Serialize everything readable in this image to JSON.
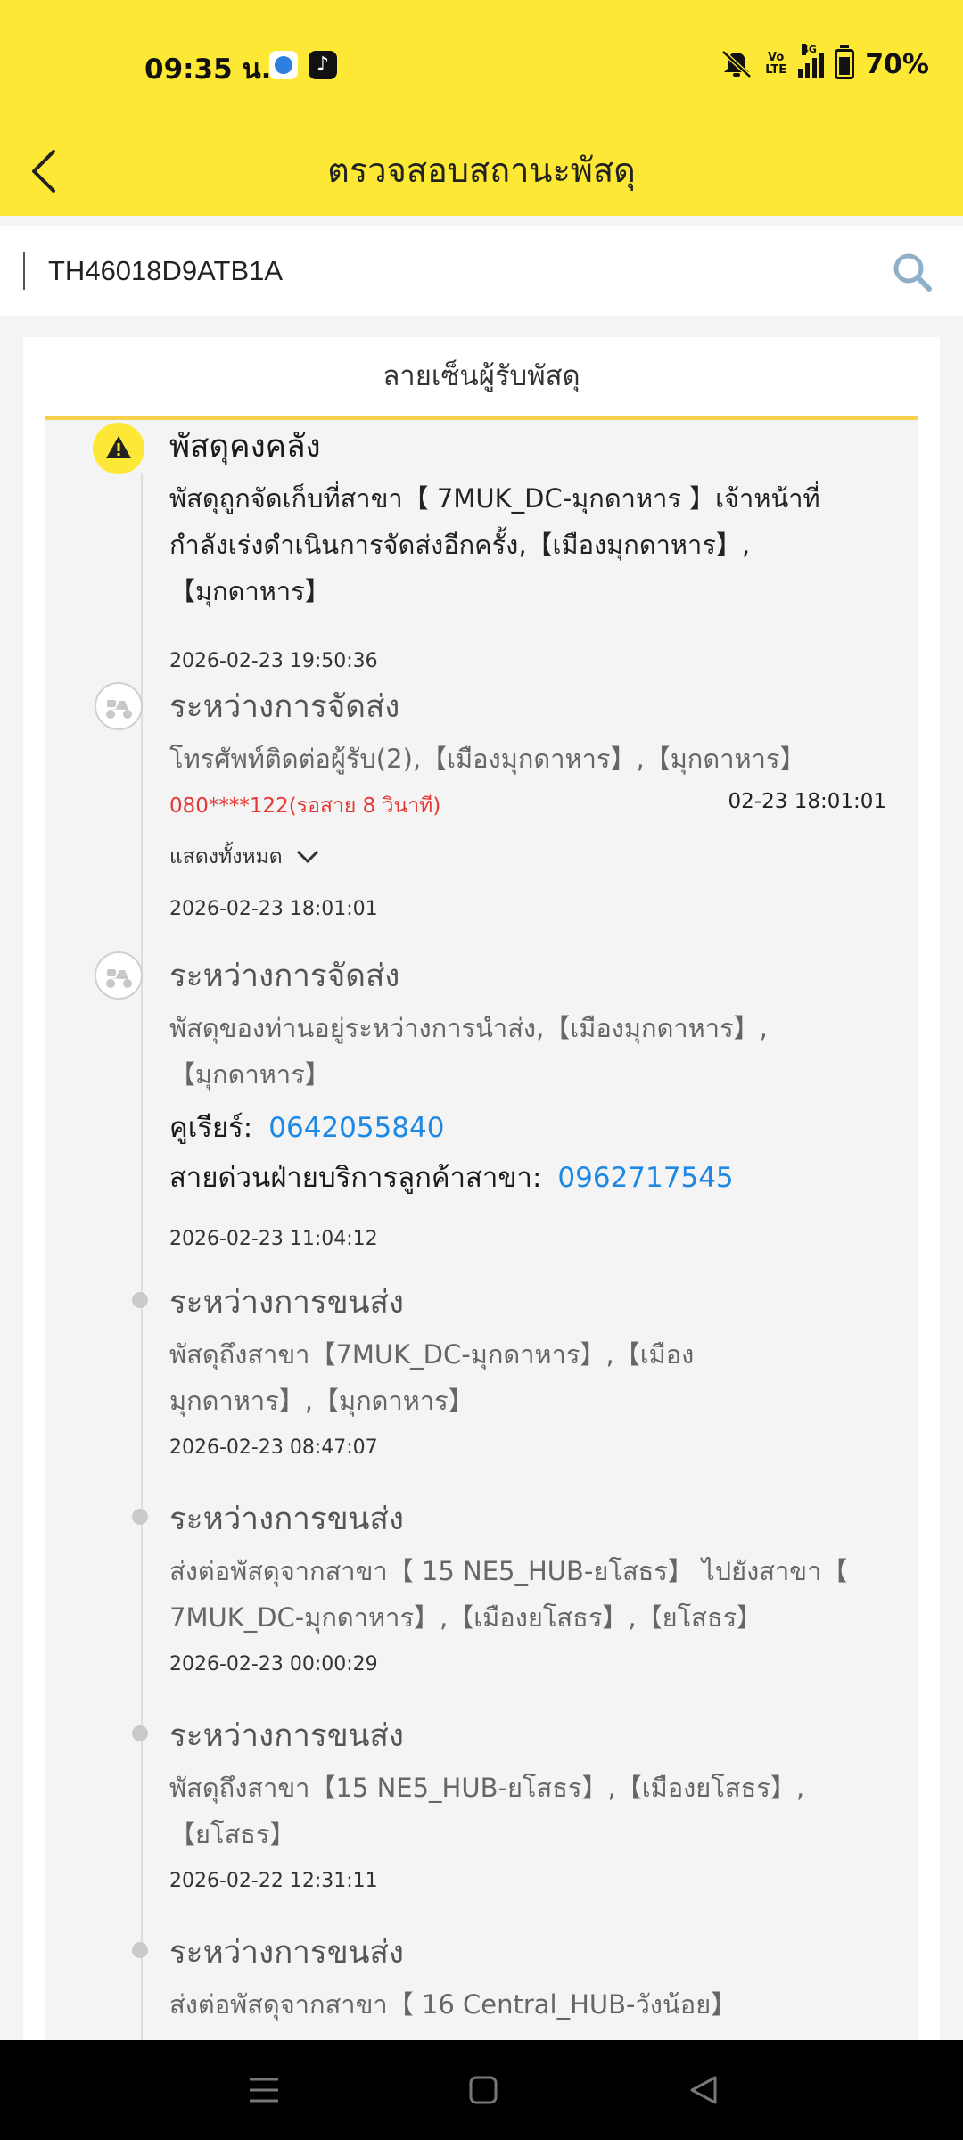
{
  "status_bar": {
    "time": "09:35 น.",
    "app2_icon": "tiktok-icon",
    "volte": "Vo LTE",
    "network": "4G",
    "battery": "70%"
  },
  "header": {
    "title": "ตรวจสอบสถานะพัสดุ",
    "back_icon": "chevron-left-icon"
  },
  "search": {
    "value": "TH46018D9ATB1A",
    "icon": "search-icon"
  },
  "signature_tab": {
    "label": "ลายเซ็นผู้รับพัสดุ"
  },
  "timeline": [
    {
      "icon": "warning-icon",
      "title": "พัสดุคงคลัง",
      "description": "พัสดุถูกจัดเก็บที่สาขา【 7MUK_DC-มุกดาหาร 】เจ้าหน้าที่กำลังเร่งดำเนินการจัดส่งอีกครั้ง,【เมืองมุกดาหาร】,【มุกดาหาร】",
      "timestamp": "2026-02-23 19:50:36"
    },
    {
      "icon": "scooter-icon",
      "title": "ระหว่างการจัดส่ง",
      "description": "โทรศัพท์ติดต่อผู้รับ(2),【เมืองมุกดาหาร】,【มุกดาหาร】",
      "call_info": "080****122(รอสาย 8 วินาที)",
      "call_time": "02-23 18:01:01",
      "show_all": "แสดงทั้งหมด",
      "timestamp": "2026-02-23 18:01:01"
    },
    {
      "icon": "scooter-icon",
      "title": "ระหว่างการจัดส่ง",
      "description": "พัสดุของท่านอยู่ระหว่างการนำส่ง,【เมืองมุกดาหาร】,【มุกดาหาร】",
      "courier_label": "คูเรียร์:",
      "courier_phone": "0642055840",
      "hotline_label": "สายด่วนฝ่ายบริการลูกค้าสาขา:",
      "hotline_phone": "0962717545",
      "timestamp": "2026-02-23 11:04:12"
    },
    {
      "title": "ระหว่างการขนส่ง",
      "description": "พัสดุถึงสาขา【7MUK_DC-มุกดาหาร】,【เมืองมุกดาหาร】,【มุกดาหาร】",
      "timestamp": "2026-02-23 08:47:07"
    },
    {
      "title": "ระหว่างการขนส่ง",
      "description": "ส่งต่อพัสดุจากสาขา【 15 NE5_HUB-ยโสธร】 ไปยังสาขา【 7MUK_DC-มุกดาหาร】,【เมืองยโสธร】,【ยโสธร】",
      "timestamp": "2026-02-23 00:00:29"
    },
    {
      "title": "ระหว่างการขนส่ง",
      "description": "พัสดุถึงสาขา【15 NE5_HUB-ยโสธร】,【เมืองยโสธร】,【ยโสธร】",
      "timestamp": "2026-02-22 12:31:11"
    },
    {
      "title": "ระหว่างการขนส่ง",
      "description": "ส่งต่อพัสดุจากสาขา【 16 Central_HUB-วังน้อย】"
    }
  ],
  "colors": {
    "brand_yellow": "#fde935",
    "tab_underline": "#f6d14c",
    "link_blue": "#1e88e5",
    "alert_red": "#e53935"
  },
  "nav_bar": {
    "icons": [
      "menu-icon",
      "home-icon",
      "back-icon"
    ]
  }
}
